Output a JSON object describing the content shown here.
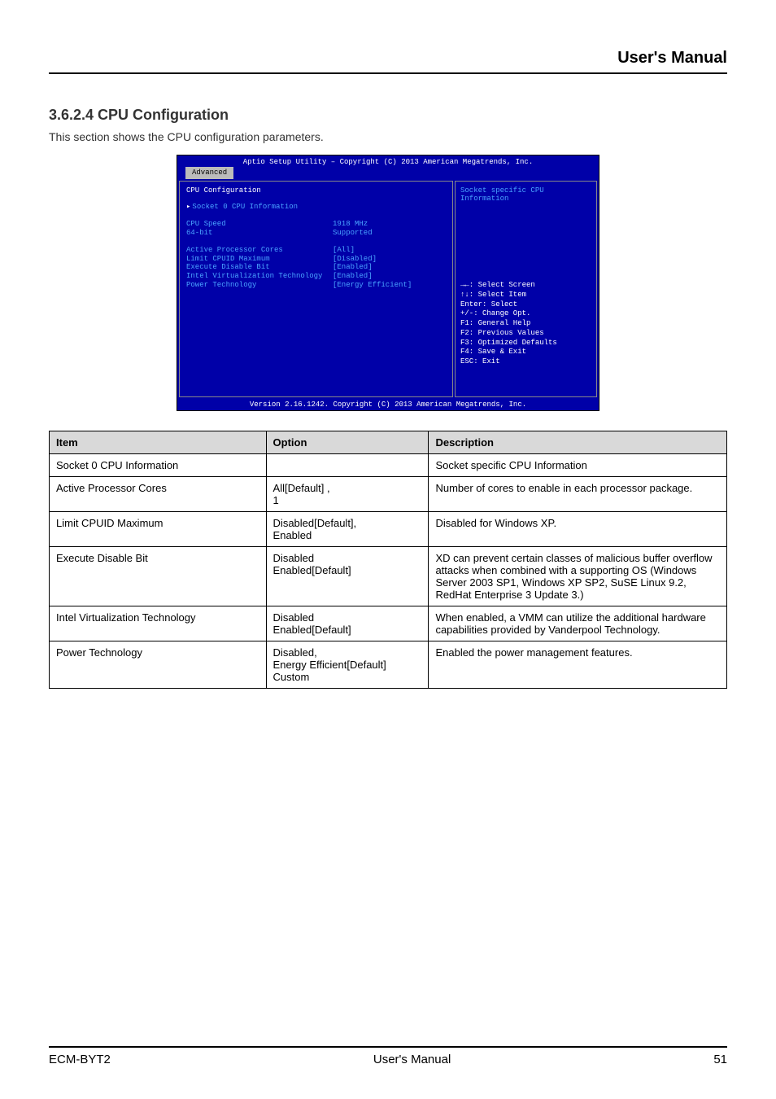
{
  "header": {
    "title": "User's Manual"
  },
  "section": {
    "heading": "3.6.2.4 CPU Configuration",
    "sub": "This section shows the CPU configuration parameters."
  },
  "bios": {
    "top": "Aptio Setup Utility – Copyright (C) 2013 American Megatrends, Inc.",
    "tab": "Advanced",
    "left_title": "CPU Configuration",
    "submenu": "Socket 0 CPU Information",
    "info_rows": [
      {
        "label": "CPU Speed",
        "value": "1918 MHz"
      },
      {
        "label": "64-bit",
        "value": "Supported"
      }
    ],
    "opt_rows": [
      {
        "label": "Active Processor Cores",
        "value": "[All]"
      },
      {
        "label": "Limit CPUID Maximum",
        "value": "[Disabled]"
      },
      {
        "label": "Execute Disable Bit",
        "value": "[Enabled]"
      },
      {
        "label": "Intel Virtualization Technology",
        "value": "[Enabled]"
      },
      {
        "label": "Power Technology",
        "value": "[Energy Efficient]"
      }
    ],
    "right_desc": "Socket specific CPU Information",
    "keyhelp": [
      "→←: Select Screen",
      "↑↓: Select Item",
      "Enter: Select",
      "+/-: Change Opt.",
      "F1: General Help",
      "F2: Previous Values",
      "F3: Optimized Defaults",
      "F4: Save & Exit",
      "ESC: Exit"
    ],
    "bottom": "Version 2.16.1242. Copyright (C) 2013 American Megatrends, Inc."
  },
  "table": {
    "headers": [
      "Item",
      "Option",
      "Description"
    ],
    "rows": [
      {
        "item": "Socket 0 CPU Information",
        "option": "",
        "description": "Socket specific CPU Information"
      },
      {
        "item": "Active Processor Cores",
        "option": "All[Default] ,\n1",
        "description": "Number of cores to enable in each processor package."
      },
      {
        "item": "Limit CPUID Maximum",
        "option": "Disabled[Default],\nEnabled",
        "description": "Disabled for Windows XP."
      },
      {
        "item": "Execute Disable Bit",
        "option": "Disabled\nEnabled[Default]",
        "description": "XD can prevent certain classes of malicious buffer overflow attacks when combined with a supporting OS (Windows Server 2003 SP1, Windows XP SP2, SuSE Linux 9.2, RedHat Enterprise 3 Update 3.)"
      },
      {
        "item": "Intel Virtualization Technology",
        "option": "Disabled\nEnabled[Default]",
        "description": "When enabled, a VMM can utilize the additional hardware capabilities provided by Vanderpool Technology."
      },
      {
        "item": "Power Technology",
        "option": "Disabled,\nEnergy Efficient[Default]\nCustom",
        "description": "Enabled the power management features."
      }
    ]
  },
  "footer": {
    "left": "ECM-BYT2",
    "center": "User's Manual",
    "right": "51"
  }
}
